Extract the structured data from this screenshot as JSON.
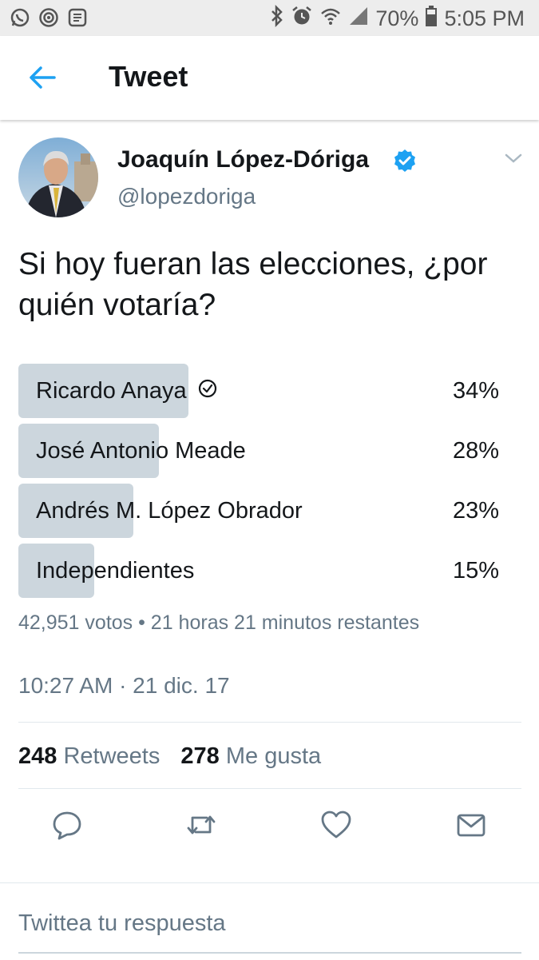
{
  "status_bar": {
    "left_icons": [
      "whatsapp-icon",
      "target-icon",
      "notes-icon"
    ],
    "battery": "70%",
    "time": "5:05 PM",
    "right_icons": [
      "bluetooth-icon",
      "alarm-icon",
      "wifi-icon",
      "signal-icon",
      "battery-icon"
    ]
  },
  "header": {
    "title": "Tweet"
  },
  "tweet": {
    "author_name": "Joaquín López-Dóriga",
    "handle": "@lopezdoriga",
    "text": "Si hoy fueran las elecciones, ¿por quién votaría?",
    "poll": {
      "options": [
        {
          "label": "Ricardo Anaya",
          "percent": "34%",
          "fraction": 0.348,
          "selected": true
        },
        {
          "label": "José Antonio Meade",
          "percent": "28%",
          "fraction": 0.288
        },
        {
          "label": "Andrés M. López Obrador",
          "percent": "23%",
          "fraction": 0.235
        },
        {
          "label": "Independientes",
          "percent": "15%",
          "fraction": 0.155
        }
      ],
      "meta": "42,951 votos • 21 horas 21 minutos restantes"
    },
    "timestamp": "10:27 AM · 21 dic. 17",
    "retweets_count": "248",
    "retweets_label": "Retweets",
    "likes_count": "278",
    "likes_label": "Me gusta"
  },
  "reply": {
    "placeholder": "Twittea tu respuesta"
  },
  "colors": {
    "accent": "#1da1f2",
    "poll_bar": "#ccd6dd",
    "muted": "#657786"
  }
}
